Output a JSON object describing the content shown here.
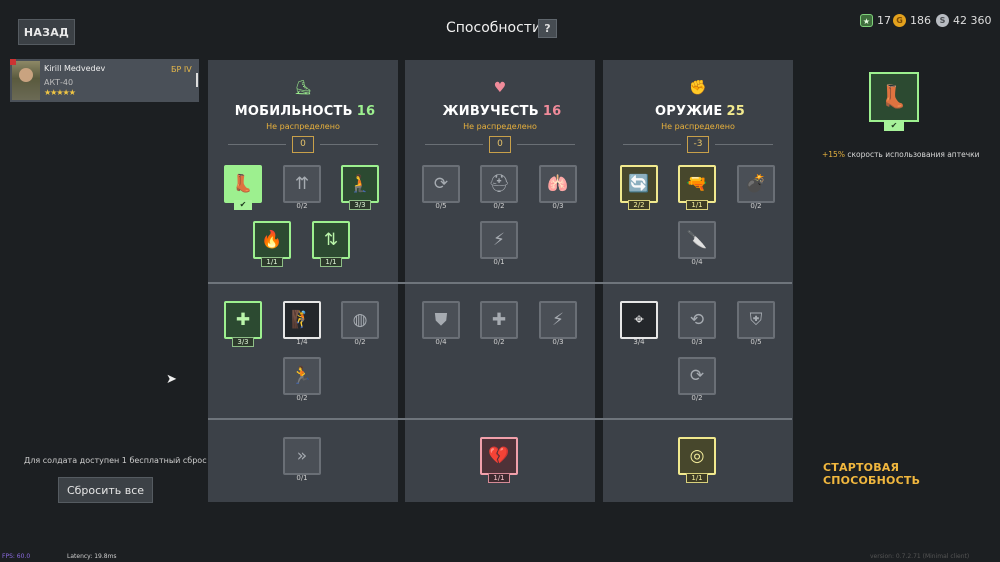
{
  "header": {
    "back_label": "НАЗАД",
    "title": "Способности",
    "help_label": "?"
  },
  "currencies": [
    {
      "icon": "ticket-icon",
      "value": "17",
      "color": "#7fd17a"
    },
    {
      "icon": "gold-coin-icon",
      "value": "186",
      "color": "#e3a11d"
    },
    {
      "icon": "silver-coin-icon",
      "value": "42 360",
      "color": "#b8bcc2"
    }
  ],
  "soldier": {
    "name": "Kirill Medvedev",
    "rank": "БР IV",
    "weapon": "АКТ-40",
    "stars": "★★★★★"
  },
  "left_panel": {
    "reset_note": "Для солдата доступен 1 бесплатный сброс",
    "reset_label": "Сбросить все"
  },
  "columns": [
    {
      "icon": "boot-icon",
      "icon_glyph": "⛸",
      "icon_color": "#9df08f",
      "name": "МОБИЛЬНОСТЬ",
      "level": "16",
      "level_color": "#9df08f",
      "unallocated": "Не распределено",
      "points": "0",
      "skills": [
        {
          "name": "boot-skill",
          "glyph": "👢",
          "level": "",
          "style": "gfill"
        },
        {
          "name": "sprint-arrows-skill",
          "glyph": "⇈",
          "level": "0/2",
          "style": ""
        },
        {
          "name": "crawl-skill",
          "glyph": "🧎",
          "level": "3/3",
          "style": "green"
        },
        {
          "name": "fire-resist-skill",
          "glyph": "🔥",
          "level": "1/1",
          "style": "green"
        },
        {
          "name": "stance-switch-skill",
          "glyph": "⇅",
          "level": "1/1",
          "style": "green"
        },
        {
          "name": "medkit-speed-skill",
          "glyph": "✚",
          "level": "3/3",
          "style": "green"
        },
        {
          "name": "climb-skill",
          "glyph": "🧗",
          "level": "1/4",
          "style": "white"
        },
        {
          "name": "lungs-skill",
          "glyph": "◍",
          "level": "0/2",
          "style": ""
        },
        {
          "name": "runner-skill",
          "glyph": "🏃",
          "level": "0/2",
          "style": ""
        },
        {
          "name": "dash-skill",
          "glyph": "»",
          "level": "0/1",
          "style": ""
        }
      ]
    },
    {
      "icon": "heart-icon",
      "icon_glyph": "♥",
      "icon_color": "#f08b9a",
      "name": "ЖИВУЧЕСТЬ",
      "level": "16",
      "level_color": "#f08b9a",
      "unallocated": "Не распределено",
      "points": "0",
      "skills": [
        {
          "name": "revive-skill",
          "glyph": "⟳",
          "level": "0/5",
          "style": ""
        },
        {
          "name": "helmet-skill",
          "glyph": "⛑",
          "level": "0/2",
          "style": ""
        },
        {
          "name": "lung-skill",
          "glyph": "🫁",
          "level": "0/3",
          "style": ""
        },
        {
          "name": "stamina-regen-skill",
          "glyph": "⚡",
          "level": "0/1",
          "style": ""
        },
        {
          "name": "armor-skill",
          "glyph": "⛊",
          "level": "0/4",
          "style": ""
        },
        {
          "name": "health-up-skill",
          "glyph": "✚",
          "level": "0/2",
          "style": ""
        },
        {
          "name": "stamina-up-skill",
          "glyph": "⚡",
          "level": "0/3",
          "style": ""
        },
        {
          "name": "heart-boost-skill",
          "glyph": "💔",
          "level": "1/1",
          "style": "red"
        }
      ]
    },
    {
      "icon": "fist-icon",
      "icon_glyph": "✊",
      "icon_color": "#f1e98e",
      "name": "ОРУЖИЕ",
      "level": "25",
      "level_color": "#f1e98e",
      "unallocated": "Не распределено",
      "points": "-3",
      "skills": [
        {
          "name": "swap-skill",
          "glyph": "🔄",
          "level": "2/2",
          "style": "yellow"
        },
        {
          "name": "pistol-skill",
          "glyph": "🔫",
          "level": "1/1",
          "style": "yellow"
        },
        {
          "name": "grenade-skill",
          "glyph": "💣",
          "level": "0/2",
          "style": ""
        },
        {
          "name": "knife-skill",
          "glyph": "🔪",
          "level": "0/4",
          "style": ""
        },
        {
          "name": "aim-skill",
          "glyph": "⌖",
          "level": "3/4",
          "style": "white"
        },
        {
          "name": "reload-skill",
          "glyph": "⟲",
          "level": "0/3",
          "style": ""
        },
        {
          "name": "ammo-box-skill",
          "glyph": "⛨",
          "level": "0/5",
          "style": ""
        },
        {
          "name": "mag-skill",
          "glyph": "⟳",
          "level": "0/2",
          "style": ""
        },
        {
          "name": "focus-skill",
          "glyph": "◎",
          "level": "1/1",
          "style": "yellow"
        }
      ]
    }
  ],
  "starting_ability": {
    "glyph": "👢",
    "desc_pct": "+15%",
    "desc_text": " скорость использования аптечки",
    "label": "СТАРТОВАЯ СПОСОБНОСТЬ"
  },
  "footer": {
    "fps": "FPS: 60.0",
    "latency": "Latency:  19.8ms",
    "version": "version: 0.7.2.71 (Minimal client)"
  }
}
